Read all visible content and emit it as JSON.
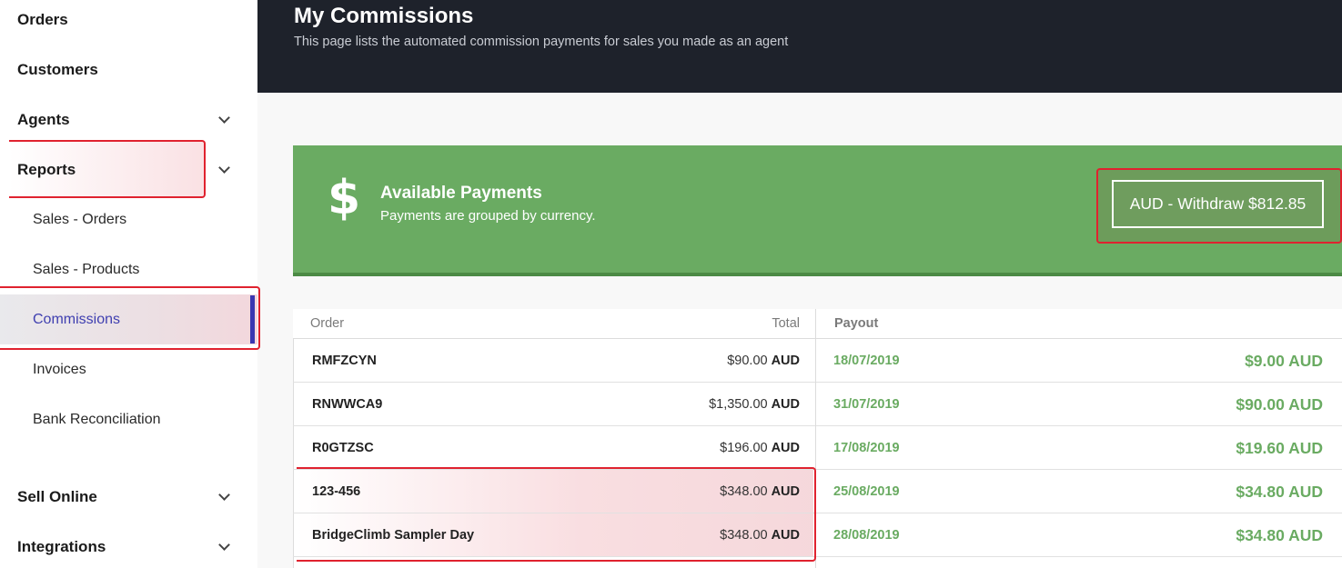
{
  "sidebar": {
    "items": [
      {
        "label": "Orders",
        "level": "top",
        "chevron": false
      },
      {
        "label": "Customers",
        "level": "top",
        "chevron": false
      },
      {
        "label": "Agents",
        "level": "top",
        "chevron": true
      },
      {
        "label": "Reports",
        "level": "top",
        "chevron": true
      },
      {
        "label": "Sales - Orders",
        "level": "sub",
        "chevron": false
      },
      {
        "label": "Sales - Products",
        "level": "sub",
        "chevron": false
      },
      {
        "label": "Commissions",
        "level": "sub",
        "chevron": false,
        "active": true
      },
      {
        "label": "Invoices",
        "level": "sub",
        "chevron": false
      },
      {
        "label": "Bank Reconciliation",
        "level": "sub",
        "chevron": false
      },
      {
        "label": "Sell Online",
        "level": "top",
        "chevron": true
      },
      {
        "label": "Integrations",
        "level": "top",
        "chevron": true
      }
    ]
  },
  "header": {
    "title": "My Commissions",
    "description": "This page lists the automated commission payments for sales you made as an agent"
  },
  "banner": {
    "icon": "dollar-icon",
    "title": "Available Payments",
    "subtitle": "Payments are grouped by currency.",
    "withdraw_label": "AUD - Withdraw $812.85"
  },
  "table": {
    "headers": {
      "order": "Order",
      "total": "Total",
      "payout": "Payout"
    },
    "rows": [
      {
        "order": "RMFZCYN",
        "total": "$90.00",
        "currency": "AUD",
        "date": "18/07/2019",
        "payout": "$9.00 AUD"
      },
      {
        "order": "RNWWCA9",
        "total": "$1,350.00",
        "currency": "AUD",
        "date": "31/07/2019",
        "payout": "$90.00 AUD"
      },
      {
        "order": "R0GTZSC",
        "total": "$196.00",
        "currency": "AUD",
        "date": "17/08/2019",
        "payout": "$19.60 AUD"
      },
      {
        "order": "123-456",
        "total": "$348.00",
        "currency": "AUD",
        "date": "25/08/2019",
        "payout": "$34.80 AUD"
      },
      {
        "order": "BridgeClimb Sampler Day",
        "total": "$348.00",
        "currency": "AUD",
        "date": "28/08/2019",
        "payout": "$34.80 AUD"
      }
    ]
  },
  "colors": {
    "accent": "#3a37b1",
    "banner_green": "#6aab62",
    "payout_green": "#6aab62",
    "header_bg": "#1e222b",
    "highlight_red": "#e0222f"
  }
}
